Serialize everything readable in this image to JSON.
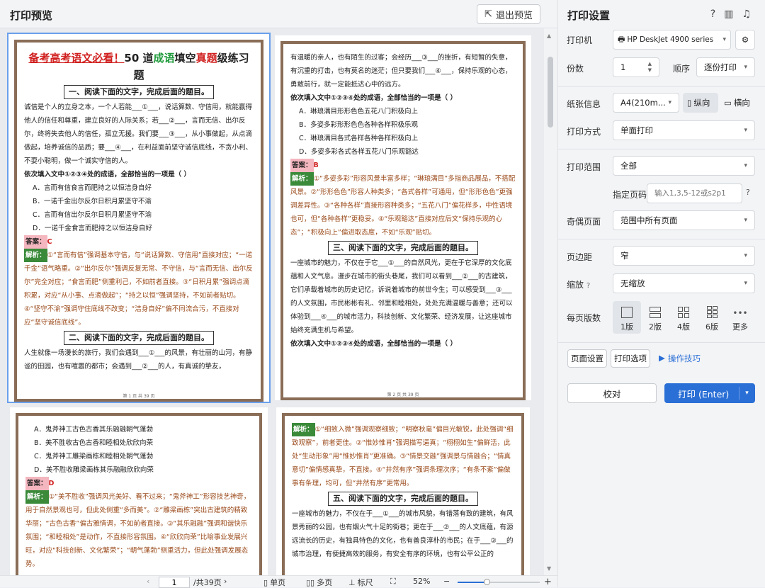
{
  "topbar": {
    "title": "打印预览",
    "exit_label": "退出预览"
  },
  "panel": {
    "title": "打印设置",
    "printer_label": "打印机",
    "printer_value": "HP DeskJet 4900 series",
    "copies_label": "份数",
    "copies_value": "1",
    "order_label": "顺序",
    "order_value": "逐份打印",
    "paper_label": "纸张信息",
    "paper_value": "A4(210m...",
    "portrait_label": "纵向",
    "landscape_label": "横向",
    "method_label": "打印方式",
    "method_value": "单面打印",
    "range_label": "打印范围",
    "range_value": "全部",
    "pages_label": "指定页码",
    "pages_placeholder": "输入1,3,5-12或s2p1",
    "oddeven_label": "奇偶页面",
    "oddeven_value": "范围中所有页面",
    "margin_label": "页边距",
    "margin_value": "窄",
    "scale_label": "缩放",
    "scale_value": "无缩放",
    "perpage_label": "每页版数",
    "layouts": [
      "1版",
      "2版",
      "4版",
      "6版",
      "更多"
    ],
    "page_setup": "页面设置",
    "print_options": "打印选项",
    "tips": "操作技巧",
    "proof": "校对",
    "print": "打印 (Enter)"
  },
  "status": {
    "page": "1",
    "total": "/共39页",
    "single": "单页",
    "multi": "多页",
    "ruler": "标尺",
    "zoom": "52%"
  },
  "doc": {
    "p1": {
      "title_a": "备考高考语文必看！",
      "title_b": "50 道",
      "title_c": "成语",
      "title_d": "填空",
      "title_e": "真题",
      "title_f": "级练习题",
      "sec1": "一、阅读下面的文字，完成后面的题目。",
      "para1": "诚信是个人的立身之本，一个人若能___①___，说话算数、守信用，就能赢得他人的信任和尊重，建立良好的人际关系；若___②___，言而无信、出尔反尔，终将失去他人的信任，孤立无援。我们要___③___，从小事做起，从点滴做起，培养诚信的品质；要___④___，在利益面前坚守诚信底线，不贪小利、不耍小聪明，做一个诚实守信的人。",
      "q1": "依次填入文中①②③④处的成语，全部恰当的一项是（ ）",
      "o1": [
        "A．言而有信食言而肥持之以恒洁身自好",
        "B．一诺千金出尔反尔日积月累坚守不渝",
        "C．言而有信出尔反尔日积月累坚守不渝",
        "D．一诺千金食言而肥持之以恒洁身自好"
      ],
      "ans_label": "答案：",
      "ans1": "C",
      "ex_label": "解析：",
      "ex1": "①“言而有信”强调基本守信，与“说话算数、守信用”直接对应；“一诺千金”语气略重。②“出尔反尔”强调反复无常、不守信，与“言而无信、出尔反尔”完全对应；“食言而肥”侧重利己，不如前者直接。③“日积月累”强调点滴积累，对应“从小事、点滴做起”；“持之以恒”强调坚持，不如前者贴切。④“坚守不渝”强调守住底线不改变；“洁身自好”偏不同流合污，不直接对应“坚守诚信底线”。",
      "sec2": "二、阅读下面的文字，完成后面的题目。",
      "para2": "人生就像一场漫长的旅行，我们会遇到___①___的风景，有壮丽的山河，有静谧的田园，也有喧嚣的都市；会遇到___②___的人，有真诚的挚友，",
      "foot": "第 1 页 共 39 页"
    },
    "p2": {
      "para1": "有温暖的亲人，也有陌生的过客；会经历___③___的挫折，有短暂的失意，有沉重的打击，也有莫名的迷茫；但只要我们___④___，保持乐观的心态，勇敢前行，就一定能抵达心中的远方。",
      "q1": "依次填入文中①②③④处的成语，全部恰当的一项是（ ）",
      "o1": [
        "A．琳琅满目形形色色五花八门积极向上",
        "B．多姿多彩形形色色各种各样积极乐观",
        "C．琳琅满目各式各样各种各样积极向上",
        "D．多姿多彩各式各样五花八门乐观豁达"
      ],
      "ans1": "B",
      "ex1": "①“多姿多彩”形容风景丰富多样；“琳琅满目”多指商品展品，不搭配风景。②“形形色色”形容人种类多；“各式各样”可通用，但“形形色色”更强调差异性。③“各种各样”直接形容种类多；“五花八门”偏花样多，中性语境也可，但“各种各样”更稳妥。④“乐观豁达”直接对应后文“保持乐观的心态”；“积极向上”偏进取态度，不如“乐观”贴切。",
      "sec3": "三、阅读下面的文字，完成后面的题目。",
      "para3": "一座城市的魅力，不仅在于它___①___的自然风光，更在于它深厚的文化底蕴和人文气息。漫步在城市的街头巷尾，我们可以看到___②___的古建筑，它们承载着城市的历史记忆，诉说着城市的前世今生；可以感受到___③___的人文氛围，市民彬彬有礼、邻里和睦相处，处处充满温暖与善意；还可以体验到___④___的城市活力，科技创新、文化繁荣、经济发展，让这座城市始终充满生机与希望。",
      "q3": "依次填入文中①②③④处的成语，全部恰当的一项是（ ）",
      "foot": "第 2 页 共 39 页"
    },
    "p3": {
      "o": [
        "A．鬼斧神工古色古香其乐融融朝气蓬勃",
        "B．美不胜收古色古香和睦相处欣欣向荣",
        "C．鬼斧神工雕梁画栋和睦相处朝气蓬勃",
        "D．美不胜收雕梁画栋其乐融融欣欣向荣"
      ],
      "ans": "D",
      "ex": "①“美不胜收”强调风光美好、看不过来；“鬼斧神工”形容技艺神奇，用于自然景观也可，但此处侧重“多而美”。②“雕梁画栋”突出古建筑的精致华丽；“古色古香”偏古雅情调，不如前者直接。③“其乐融融”强调和谐快乐氛围；“和睦相处”是动作，不直接形容氛围。④“欣欣向荣”比喻事业发展兴旺，对应“科技创新、文化繁荣”；“朝气蓬勃”侧重活力，但此处强调发展态势。"
    },
    "p4": {
      "ex": "①“细致入微”强调观察细致；“明察秋毫”偏目光敏锐，此处强调“细致观察”，前者更佳。②“惟妙惟肖”强调描写逼真；“栩栩如生”偏鲜活，此处“生动形象”用“惟妙惟肖”更准确。③“情景交融”强调景与情融合；“情真意切”偏情感真挚，不直接。④“井然有序”强调条理次序；“有条不紊”偏做事有条理，均可，但“井然有序”更常用。",
      "sec": "五、阅读下面的文字，完成后面的题目。",
      "para": "一座城市的魅力，不仅在于___①___的城市风貌，有错落有致的建筑，有风景秀丽的公园，也有烟火气十足的街巷；更在于___②___的人文底蕴，有源远流长的历史，有独具特色的文化，也有善良淳朴的市民；在于___③___的城市治理，有便捷高效的服务，有安全有序的环境，也有公平公正的"
    }
  }
}
